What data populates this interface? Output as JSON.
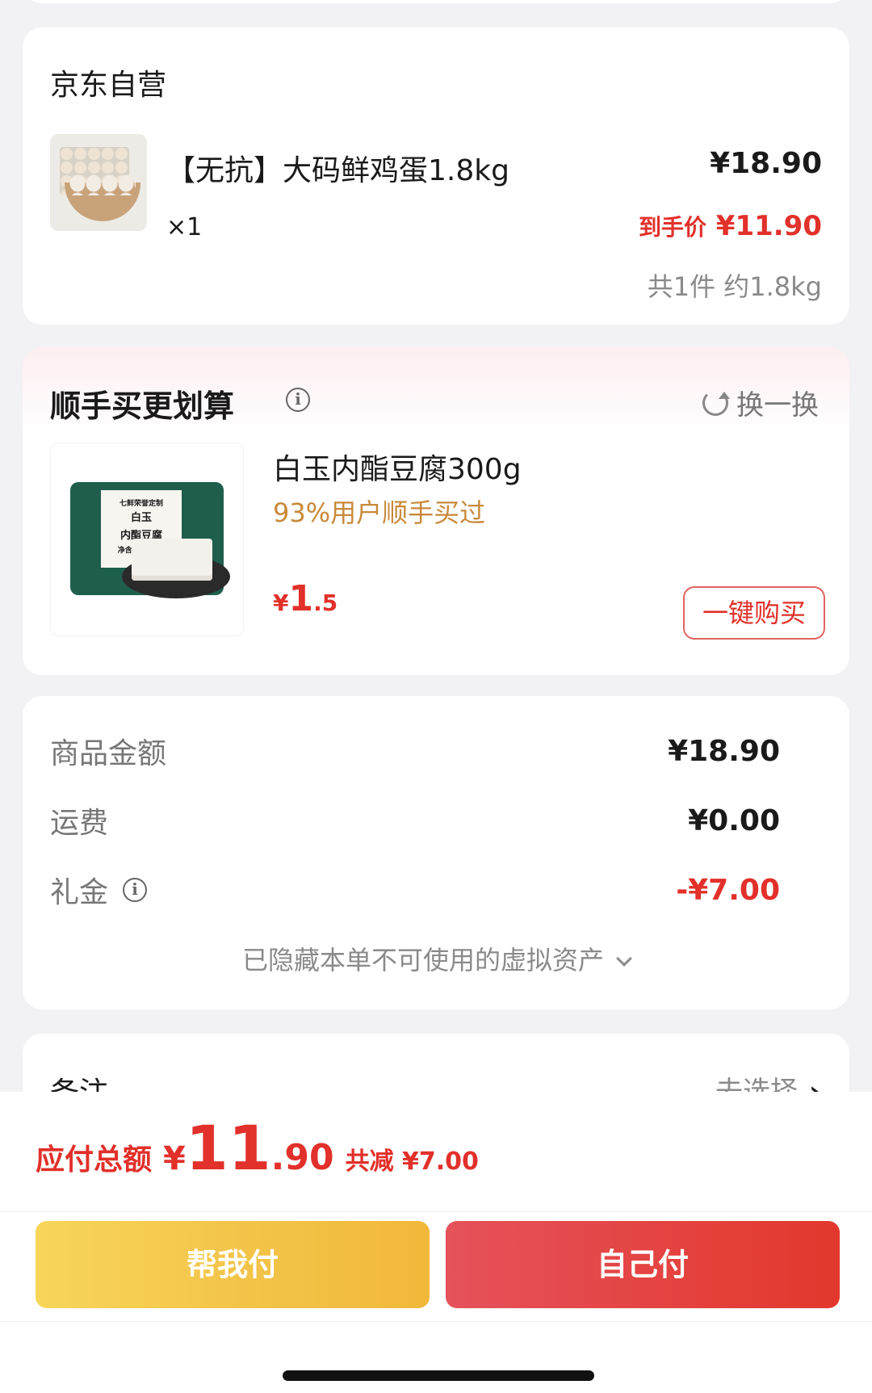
{
  "order_item": {
    "store_name": "京东自营",
    "title": "【无抗】大码鲜鸡蛋1.8kg",
    "quantity": "×1",
    "price": "¥18.90",
    "final_price_label": "到手价",
    "final_price": "¥11.90",
    "count_weight": "共1件 约1.8kg"
  },
  "upsell": {
    "title": "顺手买更划算",
    "info_icon": "info-icon",
    "swap_label": "换一换",
    "product_name": "白玉内酯豆腐300g",
    "tag": "93%用户顺手买过",
    "price_currency": "¥",
    "price_int": "1",
    "price_dec": ".5",
    "buy_button": "一键购买",
    "thumb_text_line1": "七鲜荣誉定制",
    "thumb_text_line2": "白玉",
    "thumb_text_line3": "内酯豆腐",
    "thumb_text_line4": "净含量:300克"
  },
  "summary": {
    "rows": [
      {
        "label": "商品金额",
        "value": "¥18.90"
      },
      {
        "label": "运费",
        "value": "¥0.00"
      },
      {
        "label": "礼金",
        "value": "-¥7.00"
      }
    ],
    "hidden_assets": "已隐藏本单不可使用的虚拟资产"
  },
  "remark": {
    "label": "备注",
    "action": "去选择",
    "arrow": "›"
  },
  "checkout": {
    "total_label": "应付总额",
    "total_currency": "¥",
    "total_int": "11",
    "total_dec": ".90",
    "reduced": "共减 ¥7.00",
    "help_pay": "帮我付",
    "self_pay": "自己付"
  },
  "colors": {
    "accent_red": "#e2302a",
    "tag_orange": "#c8893a",
    "help_yellow": "#f3c54a"
  }
}
